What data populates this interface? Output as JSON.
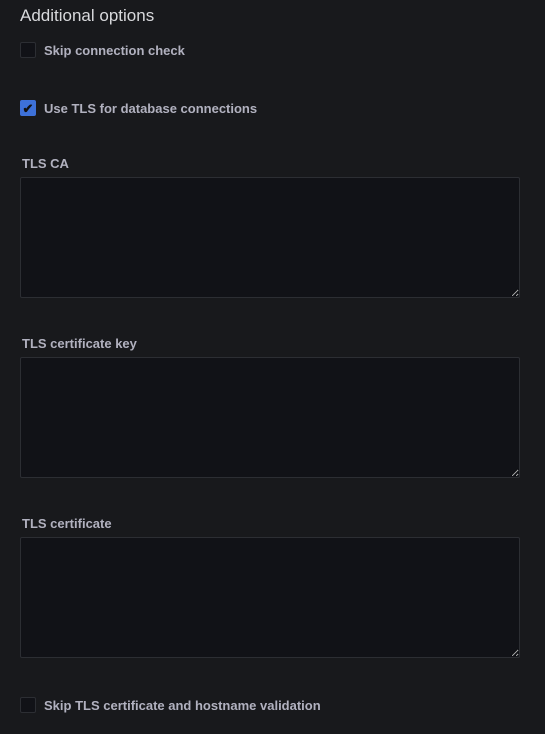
{
  "title": "Additional options",
  "skip_check": {
    "label": "Skip connection check",
    "checked": false
  },
  "use_tls": {
    "label": "Use TLS for database connections",
    "checked": true
  },
  "fields": [
    {
      "label": "TLS CA",
      "value": ""
    },
    {
      "label": "TLS certificate key",
      "value": ""
    },
    {
      "label": "TLS certificate",
      "value": ""
    }
  ],
  "skip_tls": {
    "label": "Skip TLS certificate and hostname validation",
    "checked": false
  },
  "accent": "#3d71d9"
}
